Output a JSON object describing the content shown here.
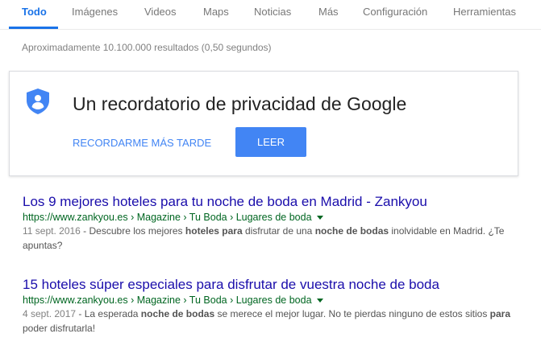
{
  "tabs": [
    {
      "label": "Todo",
      "active": true
    },
    {
      "label": "Imágenes"
    },
    {
      "label": "Videos"
    },
    {
      "label": "Maps"
    },
    {
      "label": "Noticias"
    },
    {
      "label": "Más"
    },
    {
      "label": "Configuración"
    },
    {
      "label": "Herramientas"
    }
  ],
  "stats": "Aproximadamente 10.100.000 resultados (0,50 segundos)",
  "privacy_card": {
    "icon": "privacy-shield-icon",
    "title": "Un recordatorio de privacidad de Google",
    "later_label": "RECORDARME MÁS TARDE",
    "read_label": "LEER"
  },
  "results": [
    {
      "title": "Los 9 mejores hoteles para tu noche de boda en Madrid",
      "title_sep": " - ",
      "title_site": "Zankyou",
      "url": "https://www.zankyou.es › Magazine › Tu Boda › Lugares de boda",
      "date": "11 sept. 2016",
      "snippet_parts": [
        "Descubre los mejores ",
        "hoteles",
        " ",
        "para",
        " disfrutar de una ",
        "noche de bodas",
        " inolvidable en Madrid. ¿Te apuntas?"
      ]
    },
    {
      "title": "15 hoteles súper especiales para disfrutar de vuestra noche de boda",
      "title_sep": "",
      "title_site": "",
      "url": "https://www.zankyou.es › Magazine › Tu Boda › Lugares de boda",
      "date": "4 sept. 2017",
      "snippet_parts": [
        "La esperada ",
        "noche de bodas",
        " se merece el mejor lugar. No te pierdas ninguno de estos sitios ",
        "para",
        " poder disfrutarla!"
      ]
    }
  ],
  "colors": {
    "accent": "#1a73e8",
    "button": "#4285f4",
    "link": "#1a0dab",
    "url": "#006621"
  }
}
